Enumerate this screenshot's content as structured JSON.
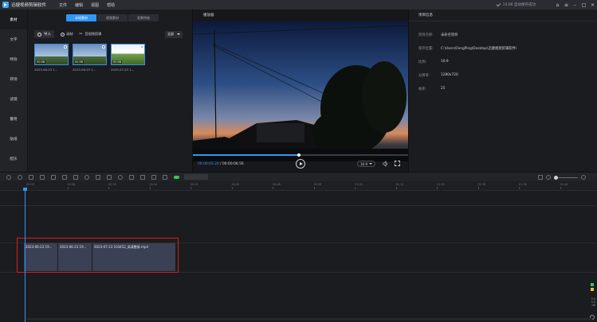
{
  "app": {
    "title": "迅捷视频剪辑软件",
    "menu": [
      "文件",
      "编辑",
      "视图",
      "帮助"
    ],
    "autosave": "15:06 自动保存成功",
    "window_controls": [
      "home-icon",
      "menu-icon",
      "minimize-icon",
      "maximize-icon",
      "close-icon"
    ]
  },
  "sidebar": {
    "items": [
      {
        "label": "素材",
        "active": true
      },
      {
        "label": "文字",
        "active": false
      },
      {
        "label": "特效",
        "active": false
      },
      {
        "label": "转场",
        "active": false
      },
      {
        "label": "滤镜",
        "active": false
      },
      {
        "label": "叠附",
        "active": false
      },
      {
        "label": "贴纸",
        "active": false
      },
      {
        "label": "配乐",
        "active": false
      }
    ]
  },
  "media": {
    "tabs": [
      {
        "label": "本地素材",
        "active": true
      },
      {
        "label": "视频素材",
        "active": false
      },
      {
        "label": "背景特效",
        "active": false
      }
    ],
    "import_label": "导入",
    "record_label": "录制",
    "trim_label": "音视频剪辑",
    "filter_label": "全部",
    "thumbnails": [
      {
        "name": "2023-06-23 1...",
        "duration": "00:06",
        "kind": "sky"
      },
      {
        "name": "2023-06-23 1...",
        "duration": "00:06",
        "kind": "sky"
      },
      {
        "name": "2023-07-23 1...",
        "duration": "00:06",
        "kind": "field"
      }
    ]
  },
  "player": {
    "title": "播放器",
    "current_time": "00:00:03.20",
    "total_time": "00:00:06.56",
    "progress": 0.49,
    "ratio": "16:9"
  },
  "project": {
    "title": "项目信息",
    "rows": [
      {
        "key": "项目名称:",
        "value": "未命名项目"
      },
      {
        "key": "保存位置:",
        "value": "C:\\Users\\FengPing\\Desktop\\迅捷视频剪辑软件\\"
      },
      {
        "key": "比例:",
        "value": "16:9"
      },
      {
        "key": "分辨率:",
        "value": "1280x720"
      },
      {
        "key": "帧率:",
        "value": "25"
      }
    ]
  },
  "timeline": {
    "ticks": [
      "00:00",
      "00:08",
      "00:16",
      "00:24",
      "00:32",
      "00:40",
      "00:48",
      "00:56",
      "01:04",
      "01:12",
      "01:20",
      "01:28",
      "01:36",
      "01:44"
    ],
    "clips": [
      {
        "label": "2023-06-23 19..."
      },
      {
        "label": "2023-06-23 19..."
      },
      {
        "label": "2023-07-23 103452_高清整屏.mp4"
      }
    ],
    "level_text": [
      "0.0",
      "0.0",
      "dB"
    ],
    "zoom": 0.0
  },
  "colors": {
    "accent": "#3196f5",
    "highlight": "#d81e1e",
    "green": "#3bc45a"
  }
}
